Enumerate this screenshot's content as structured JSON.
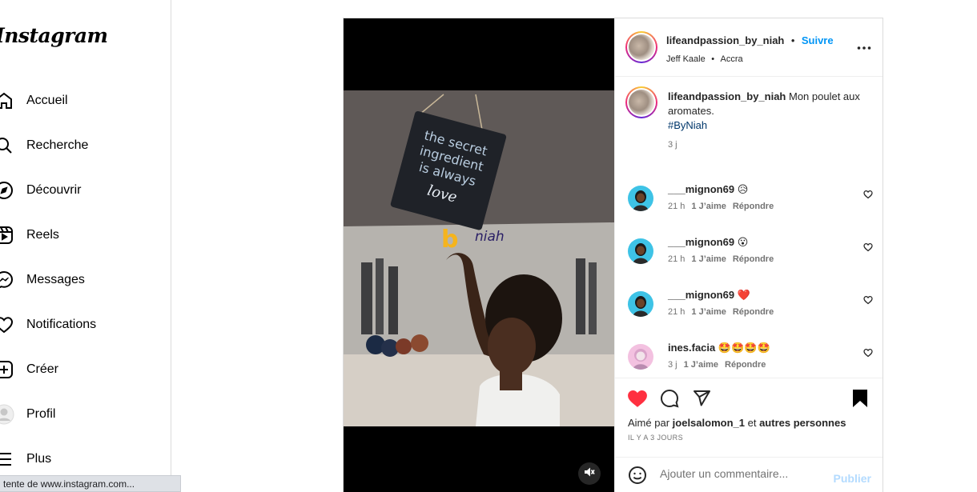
{
  "sidebar": {
    "logo": "Instagram",
    "items": [
      {
        "label": "Accueil",
        "icon": "home-icon"
      },
      {
        "label": "Recherche",
        "icon": "search-icon"
      },
      {
        "label": "Découvrir",
        "icon": "compass-icon"
      },
      {
        "label": "Reels",
        "icon": "reels-icon"
      },
      {
        "label": "Messages",
        "icon": "messenger-icon"
      },
      {
        "label": "Notifications",
        "icon": "heart-icon"
      },
      {
        "label": "Créer",
        "icon": "plus-square-icon"
      },
      {
        "label": "Profil",
        "icon": "profile-avatar"
      },
      {
        "label": "Plus",
        "icon": "menu-icon"
      }
    ]
  },
  "statusbar": {
    "text": "tente de www.instagram.com..."
  },
  "post": {
    "image_text": {
      "sign_line1": "the secret",
      "sign_line2": "ingredient",
      "sign_line3": "is always",
      "sign_line4": "love",
      "brand": "b",
      "brand_suffix": "niah"
    },
    "header": {
      "username": "lifeandpassion_by_niah",
      "separator": "•",
      "follow_label": "Suivre",
      "audio": "Jeff Kaale",
      "location_sep": "•",
      "location": "Accra"
    },
    "caption": {
      "username": "lifeandpassion_by_niah",
      "text": "Mon poulet aux aromates.",
      "hashtag": "#ByNiah",
      "time": "3 j"
    },
    "comments": [
      {
        "username": "___mignon69",
        "emoji": "😥",
        "time": "21 h",
        "likes": "1 J’aime",
        "reply": "Répondre"
      },
      {
        "username": "___mignon69",
        "emoji": "😮",
        "time": "21 h",
        "likes": "1 J’aime",
        "reply": "Répondre"
      },
      {
        "username": "___mignon69",
        "emoji": "❤️",
        "time": "21 h",
        "likes": "1 J’aime",
        "reply": "Répondre"
      },
      {
        "username": "ines.facia",
        "emoji": "🤩🤩🤩🤩",
        "time": "3 j",
        "likes": "1 J’aime",
        "reply": "Répondre"
      }
    ],
    "liked_by": {
      "prefix": "Aimé par",
      "user": "joelsalomon_1",
      "middle": "et",
      "suffix": "autres personnes"
    },
    "posted_ago": "IL Y A 3 JOURS",
    "composer": {
      "placeholder": "Ajouter un commentaire...",
      "publish_label": "Publier"
    }
  },
  "colors": {
    "accent": "#0095f6",
    "like_red": "#ff3040",
    "publish_disabled": "#b3dbff",
    "hashtag": "#00376b"
  }
}
